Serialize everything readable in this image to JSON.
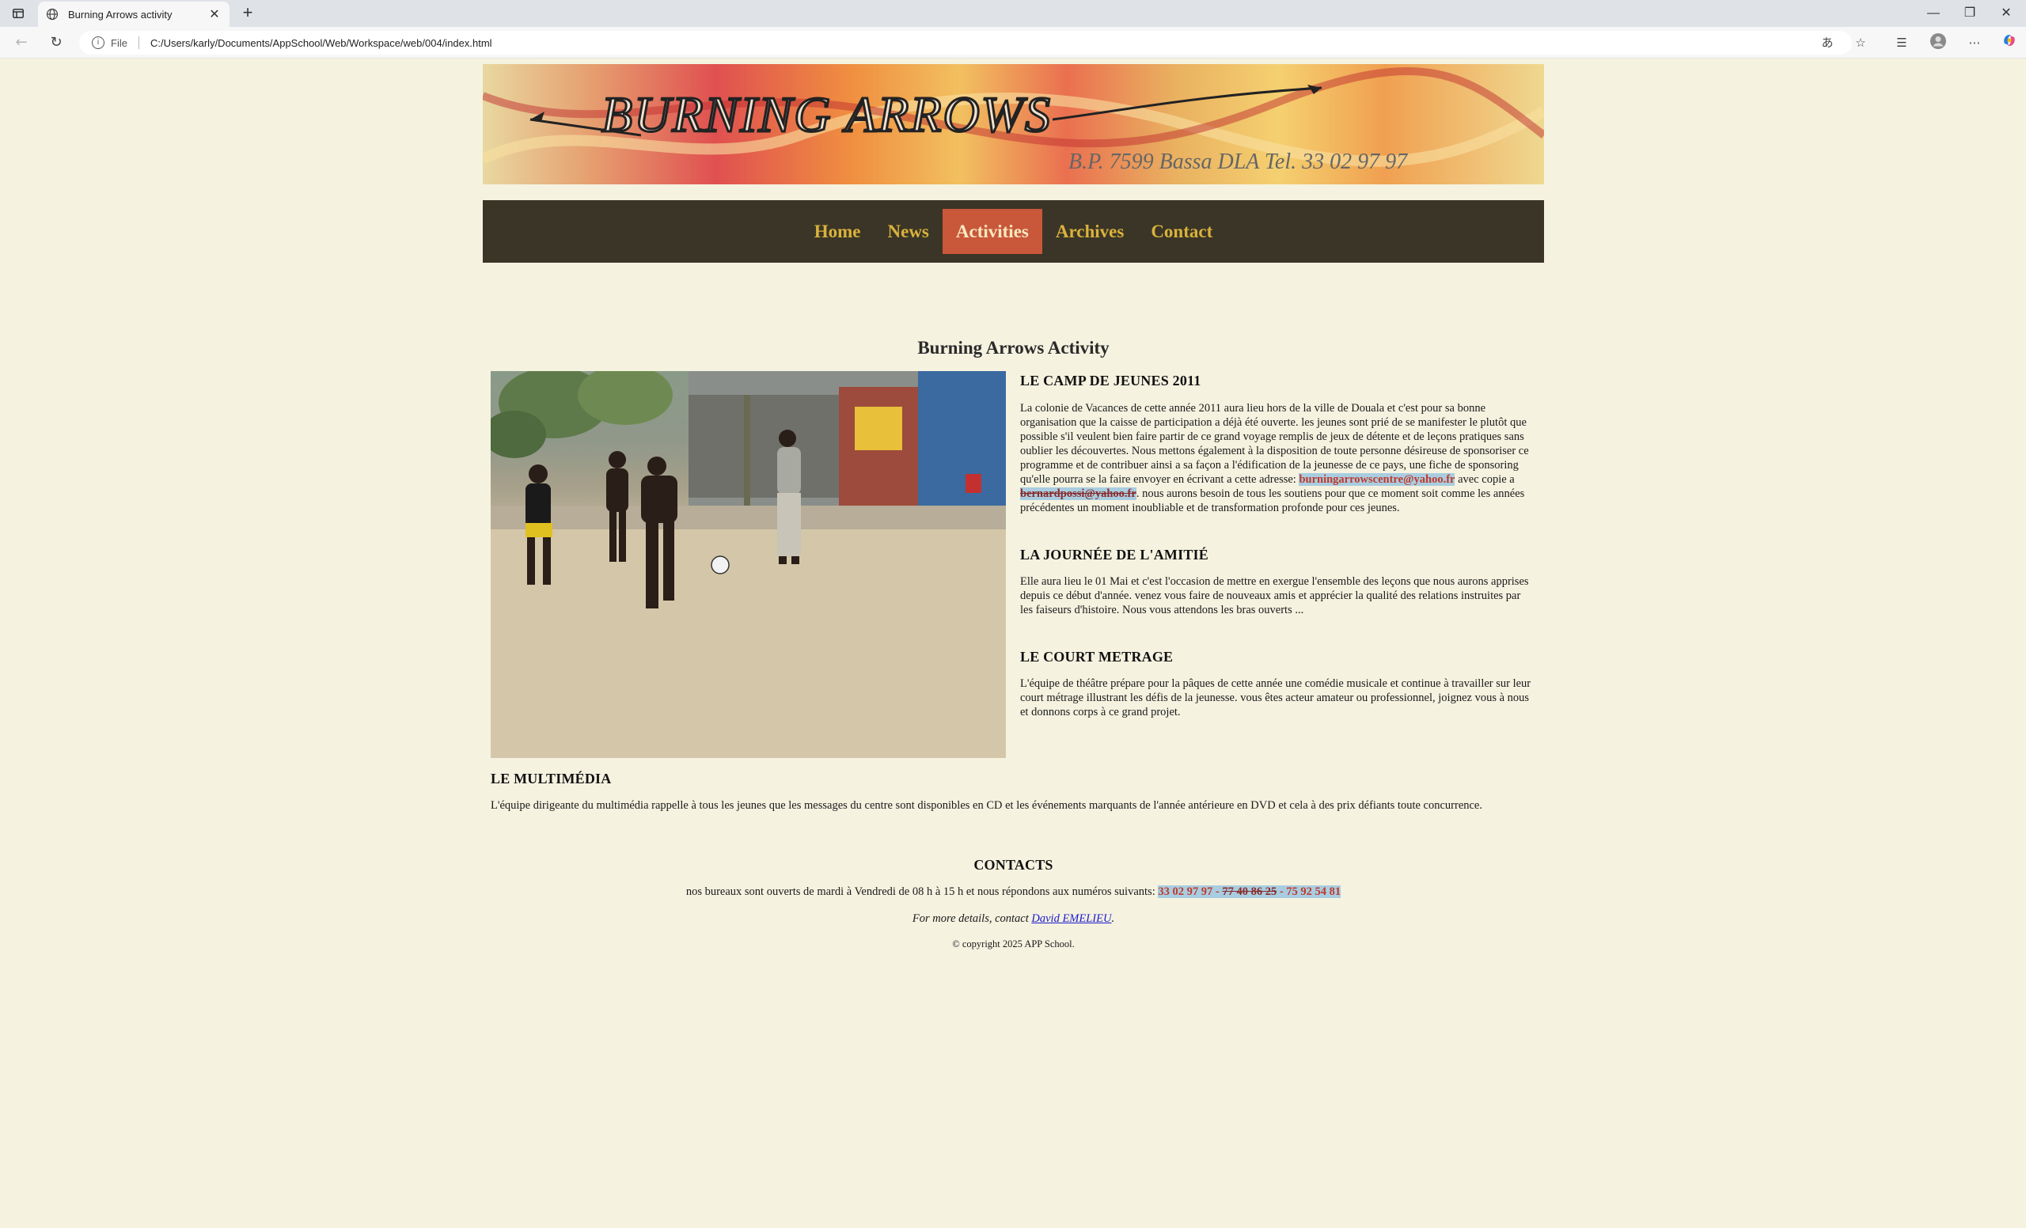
{
  "browser": {
    "tab_title": "Burning Arrows activity",
    "tab_close": "✕",
    "new_tab": "+",
    "url_scheme": "File",
    "url": "C:/Users/karly/Documents/AppSchool/Web/Workspace/web/004/index.html",
    "window": {
      "minimize": "—",
      "restore": "❐",
      "close": "✕"
    }
  },
  "banner": {
    "logo_text": "BURNING ARROWS",
    "address_text": "B.P. 7599 Bassa DLA  Tel. 33 02 97 97"
  },
  "nav": {
    "items": [
      {
        "label": "Home",
        "active": false
      },
      {
        "label": "News",
        "active": false
      },
      {
        "label": "Activities",
        "active": true
      },
      {
        "label": "Archives",
        "active": false
      },
      {
        "label": "Contact",
        "active": false
      }
    ]
  },
  "main": {
    "title": "Burning Arrows Activity",
    "camp": {
      "heading": "LE CAMP DE JEUNES 2011",
      "text_before": "La colonie de Vacances de cette année 2011 aura lieu hors de la ville de Douala et c'est pour sa bonne organisation que la caisse de participation a déjà été ouverte. les jeunes sont prié de se manifester le plutôt que possible s'il veulent bien faire partir de ce grand voyage remplis de jeux de détente et de leçons pratiques sans oublier les découvertes. Nous mettons également à la disposition de toute personne désireuse de sponsoriser ce programme et de contribuer ainsi a sa façon a l'édification de la jeunesse de ce pays, une fiche de sponsoring qu'elle pourra se la faire envoyer en écrivant a cette adresse: ",
      "email1": "burningarrowscentre@yahoo.fr",
      "text_mid": " avec copie a ",
      "email2": "bernardpossi@yahoo.fr",
      "text_after": ". nous aurons besoin de tous les soutiens pour que ce moment soit comme les années précédentes un moment inoubliable et de transformation profonde pour ces jeunes."
    },
    "amitie": {
      "heading": "LA JOURNÉE DE L'AMITIÉ",
      "text": "Elle aura lieu le 01 Mai et c'est l'occasion de mettre en exergue l'ensemble des leçons que nous aurons apprises depuis ce début d'année. venez vous faire de nouveaux amis et apprécier la qualité des relations instruites par les faiseurs d'histoire. Nous vous attendons les bras ouverts ..."
    },
    "metrage": {
      "heading": "LE COURT METRAGE",
      "text": "L'équipe de théâtre prépare pour la pâques de cette année une comédie musicale et continue à travailler sur leur court métrage illustrant les défis de la jeunesse. vous êtes acteur amateur ou professionnel, joignez vous à nous et donnons corps à ce grand projet."
    },
    "multimedia": {
      "heading": "LE MULTIMÉDIA",
      "text": "L'équipe dirigeante du multimédia rappelle à tous les jeunes que les messages du centre sont disponibles en CD et les événements marquants de l'année antérieure en DVD et cela à des prix défiants toute concurrence."
    }
  },
  "contacts": {
    "heading": "CONTACTS",
    "hours_text": "nos bureaux sont ouverts de mardi à Vendredi de 08 h à 15 h et nous répondons aux numéros suivants: ",
    "phone1": "33 02 97 97 - ",
    "phone2": "77 40 86 25",
    "phone3": " - 75 92 54 81",
    "details_prefix": "For more details, contact ",
    "details_link": "David EMELIEU",
    "details_suffix": ".",
    "copyright": "© copyright 2025 APP School."
  }
}
